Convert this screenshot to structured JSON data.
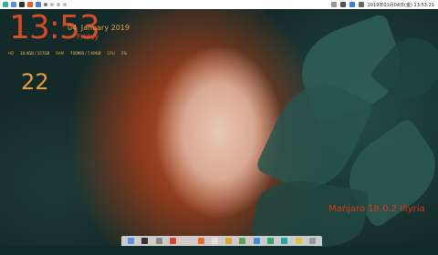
{
  "topbar": {
    "datetime": "2019年01月04日(金) 13:53:21",
    "left_icons": [
      "menu-icon",
      "folder-icon",
      "terminal-icon",
      "browser-icon",
      "editor-icon",
      "workspace-1-icon",
      "workspace-2-icon",
      "workspace-3-icon",
      "workspace-4-icon",
      "workspace-5-icon"
    ],
    "right_icons": [
      "clipboard-icon",
      "network-icon",
      "dropbox-icon",
      "volume-icon",
      "bluetooth-icon",
      "battery-icon"
    ]
  },
  "desktop_widget": {
    "clock_hour": "13:53",
    "clock_seconds": "22",
    "day": "04",
    "month_year": "January 2019",
    "weekday": "Friday",
    "stats": {
      "hd_label": "HD",
      "hd_value": "19.4GB / 157GB",
      "ram_label": "RAM",
      "ram_value": "700MiB / 7.69GB",
      "cpu_label": "CPU",
      "cpu_value": "1%"
    }
  },
  "distro_label": "Manjaro 18.0.2 Illyria",
  "dock": {
    "apps": [
      "files-icon",
      "terminal-icon",
      "settings-icon",
      "mail-icon",
      "text-editor-icon",
      "firefox-icon",
      "calendar-icon",
      "music-icon",
      "image-viewer-icon",
      "store-icon",
      "spreadsheet-icon",
      "chat-icon",
      "notes-icon",
      "trash-icon"
    ]
  },
  "colors": {
    "clock": "#d24c2a",
    "accent": "#e3a13a",
    "distro": "#d83a1c",
    "topbar": "#ffffff"
  }
}
